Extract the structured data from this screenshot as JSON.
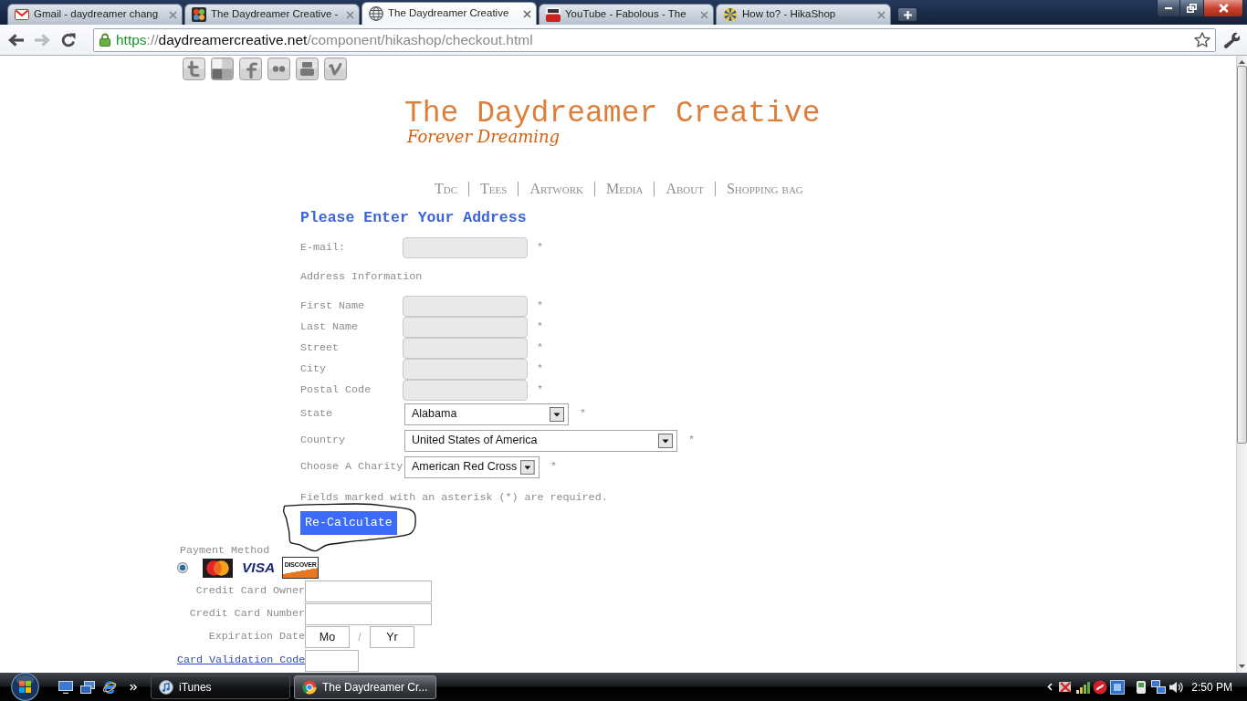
{
  "browser": {
    "tabs": [
      {
        "title": "Gmail - daydreamer chang",
        "selected": false
      },
      {
        "title": "The Daydreamer Creative -",
        "selected": false
      },
      {
        "title": "The Daydreamer Creative",
        "selected": true
      },
      {
        "title": "YouTube - Fabolous - The",
        "selected": false
      },
      {
        "title": "How to? - HikaShop",
        "selected": false
      }
    ],
    "nav_buttons": [
      {
        "kind": "back",
        "disabled": false
      },
      {
        "kind": "forward",
        "disabled": true
      },
      {
        "kind": "reload",
        "disabled": false
      }
    ],
    "url": {
      "scheme": "https",
      "separator": "://",
      "host": "daydreamercreative.net",
      "path": "/component/hikashop/checkout.html"
    }
  },
  "page": {
    "site_title": "The Daydreamer Creative",
    "tagline": "Forever Dreaming",
    "menu": [
      "Tdc",
      "Tees",
      "Artwork",
      "Media",
      "About",
      "Shopping bag"
    ],
    "address_form": {
      "title": "Please Enter Your Address",
      "rows": [
        {
          "kind": "text",
          "label": "E-mail:",
          "required_mark": "*"
        },
        {
          "kind": "heading",
          "label": "Address Information"
        },
        {
          "kind": "text",
          "label": "First Name",
          "required_mark": "*"
        },
        {
          "kind": "text",
          "label": "Last Name",
          "required_mark": "*"
        },
        {
          "kind": "text",
          "label": "Street",
          "required_mark": "*"
        },
        {
          "kind": "text",
          "label": "City",
          "required_mark": "*"
        },
        {
          "kind": "text",
          "label": "Postal Code",
          "required_mark": "*"
        },
        {
          "kind": "select",
          "label": "State",
          "value": "Alabama",
          "required_mark": "*"
        },
        {
          "kind": "select",
          "label": "Country",
          "value": "United States of America",
          "required_mark": "*"
        },
        {
          "kind": "select",
          "label": "Choose A Charity",
          "value": "American Red Cross",
          "required_mark": "*"
        }
      ],
      "note": "Fields marked with an asterisk (*) are required.",
      "button": "Re-Calculate"
    },
    "payment": {
      "title": "Payment Method",
      "methods": [
        {
          "selected": true,
          "cards": [
            {
              "kind": "emblem"
            },
            {
              "kind": "script",
              "label": "VISA"
            },
            {
              "kind": "framed",
              "label": "DISCOVER"
            }
          ]
        }
      ],
      "rows": [
        {
          "kind": "text",
          "label": "Credit Card Owner"
        },
        {
          "kind": "text",
          "label": "Credit Card Number"
        },
        {
          "kind": "expiry",
          "label": "Expiration Date",
          "month": "Mo",
          "separator": "/",
          "year": "Yr"
        },
        {
          "kind": "link",
          "label": "Card Validation Code"
        }
      ]
    }
  },
  "taskbar": {
    "buttons": [
      {
        "label": "iTunes",
        "selected": false
      },
      {
        "label": "The Daydreamer Cr...",
        "selected": true
      }
    ],
    "clock": "2:50 PM"
  }
}
